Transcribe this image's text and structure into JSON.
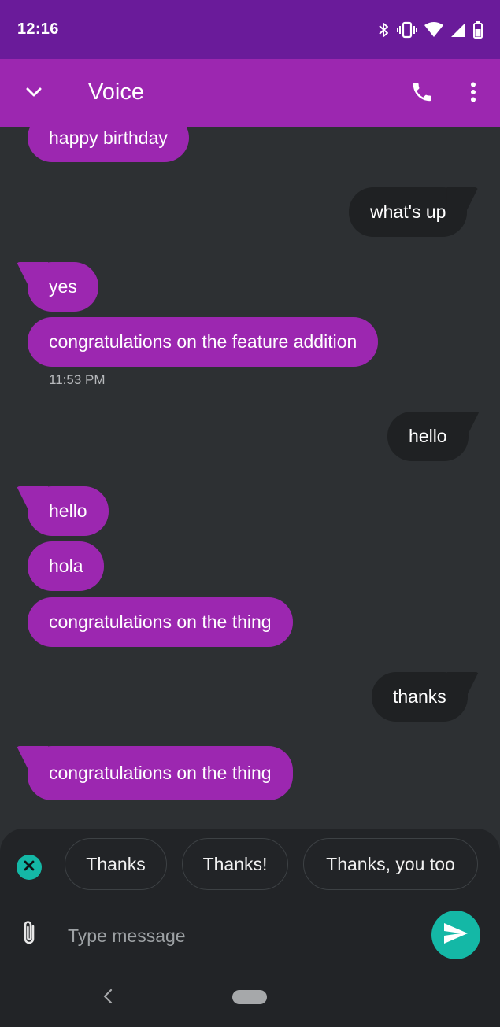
{
  "status_bar": {
    "time": "12:16",
    "icons": [
      "bluetooth-icon",
      "vibrate-icon",
      "wifi-icon",
      "cell-signal-icon",
      "battery-icon"
    ]
  },
  "app_bar": {
    "title": "Voice",
    "icons": [
      "chevron-down-icon",
      "phone-icon",
      "more-vert-icon"
    ]
  },
  "messages": [
    {
      "direction": "in",
      "text": "happy birthday"
    },
    {
      "direction": "out",
      "text": "what's up"
    },
    {
      "direction": "in",
      "text": "yes"
    },
    {
      "direction": "in",
      "text": "congratulations on the feature addition"
    },
    {
      "direction": "out",
      "text": "hello"
    },
    {
      "direction": "in",
      "text": "hello"
    },
    {
      "direction": "in",
      "text": "hola"
    },
    {
      "direction": "in",
      "text": "congratulations on the thing"
    },
    {
      "direction": "out",
      "text": "thanks"
    },
    {
      "direction": "in",
      "text": "congratulations on the thing"
    }
  ],
  "timestamps": [
    "11:53 PM"
  ],
  "smart_replies": [
    "Thanks",
    "Thanks!",
    "Thanks, you too"
  ],
  "compose": {
    "placeholder": "Type message"
  },
  "colors": {
    "status_bar": "#6a1b9a",
    "app_bar": "#9c27b0",
    "incoming_bubble": "#9c27b0",
    "outgoing_bubble": "#1f2123",
    "background": "#2d3033",
    "accent": "#14b8a6"
  }
}
